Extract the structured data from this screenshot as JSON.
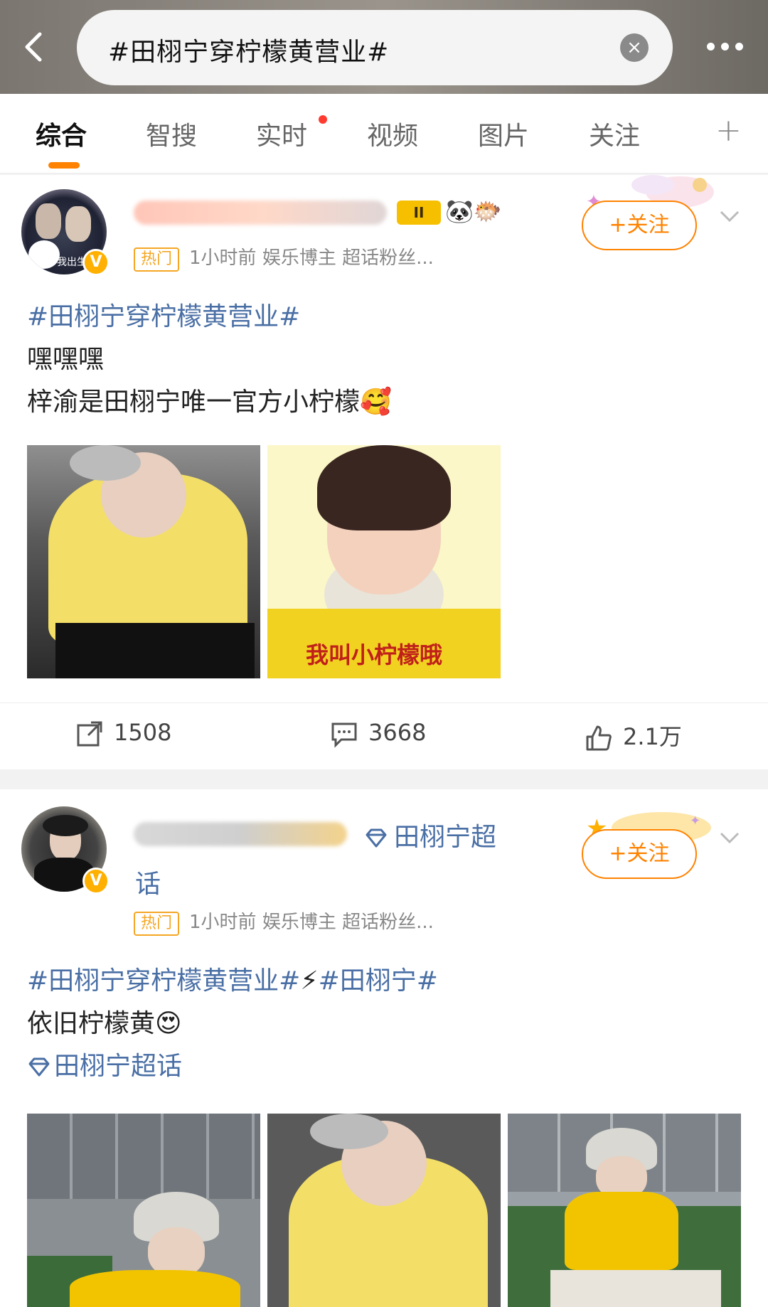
{
  "search": {
    "query": "#田栩宁穿柠檬黄营业#"
  },
  "tabs": [
    "综合",
    "智搜",
    "实时",
    "视频",
    "图片",
    "关注"
  ],
  "posts": [
    {
      "topic_line": "#田栩宁穿柠檬黄营业#",
      "line2": "嘿嘿嘿",
      "line3": "梓渝是田栩宁唯一官方小柠檬",
      "emoji3": "🥰",
      "hot": "热门",
      "meta": "1小时前  娱乐博主 超话粉丝...",
      "follow": "+关注",
      "level": "II",
      "badge_emojis": "🐼🐡",
      "avatar_text": "我出生了",
      "image2_caption": "我叫小柠檬哦",
      "reposts": "1508",
      "comments": "3668",
      "likes": "2.1万"
    },
    {
      "super_topic_name": "田栩宁超",
      "super_topic_tail": "话",
      "topic_line": "#田栩宁穿柠檬黄营业#",
      "bolt": "⚡",
      "topic2": "#田栩宁#",
      "line2": "依旧柠檬黄",
      "emoji2": "😍",
      "super_link": "田栩宁超话",
      "hot": "热门",
      "meta": "1小时前  娱乐博主 超话粉丝...",
      "follow": "+关注"
    }
  ],
  "colors": {
    "accent": "#ff8200",
    "topic": "#4a6fa5",
    "hot": "#f5a623"
  }
}
